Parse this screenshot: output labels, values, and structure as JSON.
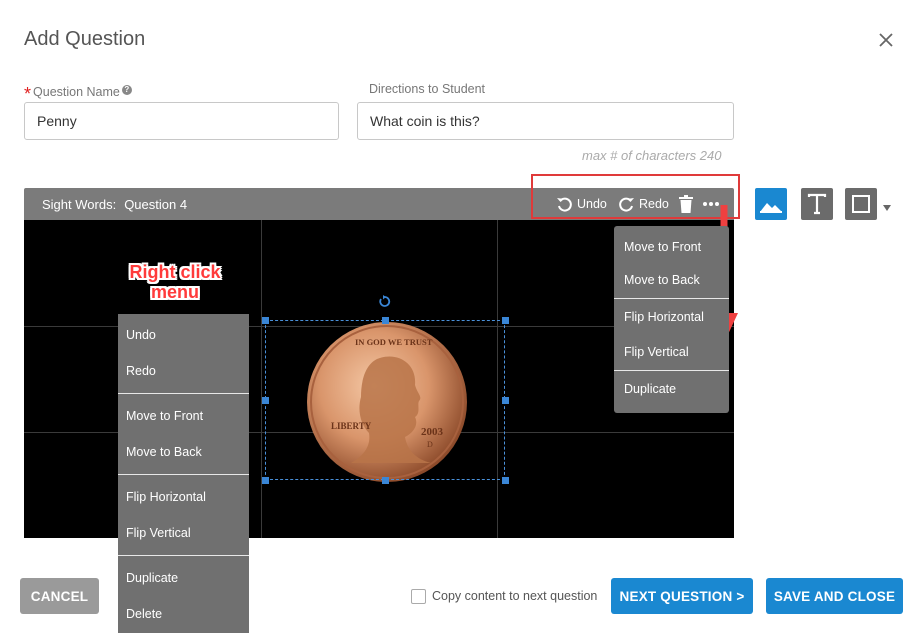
{
  "dialog": {
    "title": "Add Question",
    "close_icon": "close-icon"
  },
  "form": {
    "question_name_label": "Question Name",
    "question_name_value": "Penny",
    "directions_label": "Directions to Student",
    "directions_value": "What coin is this?",
    "max_chars_hint": "max # of characters 240"
  },
  "editor": {
    "set_label": "Sight Words:",
    "question_label": "Question 4",
    "undo_label": "Undo",
    "redo_label": "Redo",
    "icons": [
      "undo-icon",
      "redo-icon",
      "trash-icon",
      "more-icon"
    ]
  },
  "side_tools": {
    "image_icon": "image-icon",
    "text_icon": "text-icon",
    "shape_icon": "shape-icon",
    "active_color": "#1a88d1",
    "inactive_color": "#6b6b6b"
  },
  "coin": {
    "motto": "IN GOD WE TRUST",
    "liberty": "LIBERTY",
    "year": "2003",
    "mint": "D"
  },
  "annotation": {
    "line1": "Right click",
    "line2": "menu",
    "color": "#ff3b3b"
  },
  "more_menu": {
    "group1": [
      "Move to Front",
      "Move to Back"
    ],
    "group2": [
      "Flip Horizontal",
      "Flip Vertical"
    ],
    "group3": [
      "Duplicate"
    ]
  },
  "context_menu": {
    "group1": [
      "Undo",
      "Redo"
    ],
    "group2": [
      "Move to Front",
      "Move to Back"
    ],
    "group3": [
      "Flip Horizontal",
      "Flip Vertical"
    ],
    "group4": [
      "Duplicate",
      "Delete"
    ]
  },
  "footer": {
    "cancel_label": "CANCEL",
    "copy_label": "Copy content to next question",
    "next_label": "NEXT QUESTION >",
    "save_label": "SAVE AND CLOSE"
  }
}
